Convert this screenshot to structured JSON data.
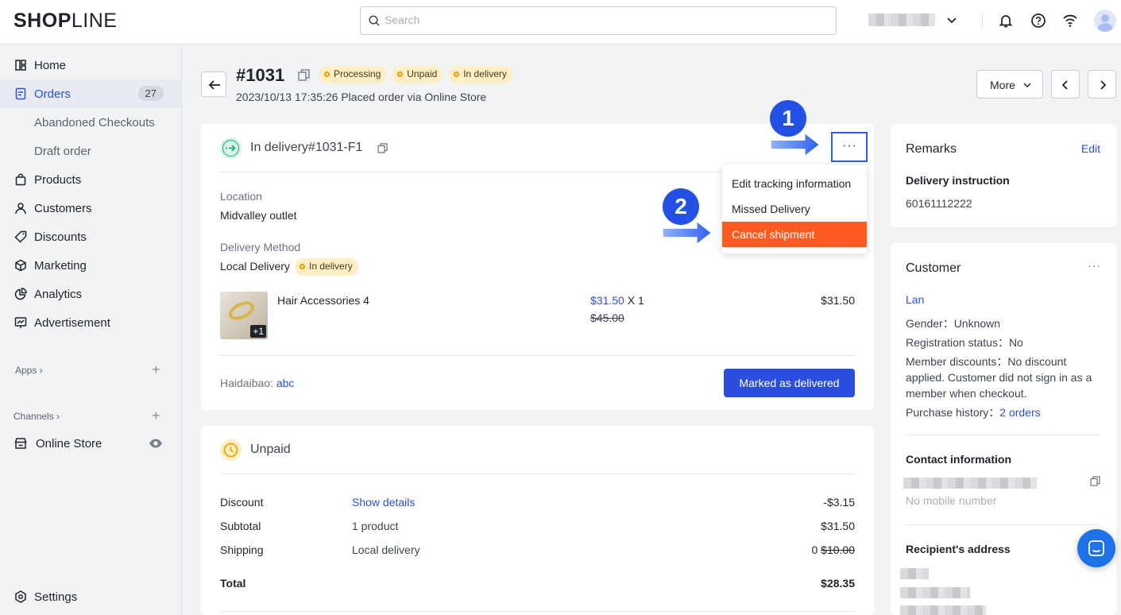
{
  "topbar": {
    "logo_left": "SH",
    "logo_o": "O",
    "logo_p": "P",
    "logo_right": "LINE",
    "search_placeholder": "Search"
  },
  "sidebar": {
    "items": [
      {
        "label": "Home"
      },
      {
        "label": "Orders",
        "badge": "27"
      },
      {
        "label": "Abandoned Checkouts"
      },
      {
        "label": "Draft order"
      },
      {
        "label": "Products"
      },
      {
        "label": "Customers"
      },
      {
        "label": "Discounts"
      },
      {
        "label": "Marketing"
      },
      {
        "label": "Analytics"
      },
      {
        "label": "Advertisement"
      }
    ],
    "apps_label": "Apps",
    "channels_label": "Channels",
    "online_store": "Online Store",
    "settings": "Settings"
  },
  "order": {
    "number": "#1031",
    "badges": [
      "Processing",
      "Unpaid",
      "In delivery"
    ],
    "subtitle": "2023/10/13 17:35:26 Placed order via Online Store",
    "more_label": "More"
  },
  "fulfillment": {
    "title": "In delivery#1031-F1",
    "location_label": "Location",
    "location": "Midvalley outlet",
    "method_label": "Delivery Method",
    "method": "Local Delivery",
    "method_badge": "In delivery",
    "product_name": "Hair Accessories 4",
    "product_more": "+1",
    "price": "$31.50",
    "qty": "X 1",
    "original_price": "$45.00",
    "line_total": "$31.50",
    "courier_label": "Haidaibao:",
    "courier_value": "abc",
    "primary_button": "Marked as delivered",
    "menu": [
      "Edit tracking information",
      "Missed Delivery",
      "Cancel shipment"
    ],
    "step1": "1",
    "step2": "2"
  },
  "payment": {
    "title": "Unpaid",
    "rows": [
      {
        "label": "Discount",
        "mid": "Show details",
        "value": "-$3.15"
      },
      {
        "label": "Subtotal",
        "mid": "1 product",
        "value": "$31.50"
      },
      {
        "label": "Shipping",
        "mid": "Local delivery",
        "value": "0",
        "struck": "$10.00"
      }
    ],
    "total_label": "Total",
    "total_value": "$28.35"
  },
  "remarks": {
    "title": "Remarks",
    "edit": "Edit",
    "instruction_label": "Delivery instruction",
    "instruction": "60161112222"
  },
  "customer": {
    "title": "Customer",
    "name": "Lan",
    "gender": "Gender：Unknown",
    "registration": "Registration status：No",
    "member": "Member discounts：No discount applied. Customer did not sign in as a member when checkout.",
    "history_label": "Purchase history：",
    "history_link": "2 orders",
    "contact_title": "Contact information",
    "no_mobile": "No mobile number",
    "address_title": "Recipient's address"
  },
  "colors": {
    "accent": "#2b4ee0",
    "button": "#2b4ee0",
    "highlight": "#ff5a1f",
    "badge_bg": "#fdefc3"
  }
}
